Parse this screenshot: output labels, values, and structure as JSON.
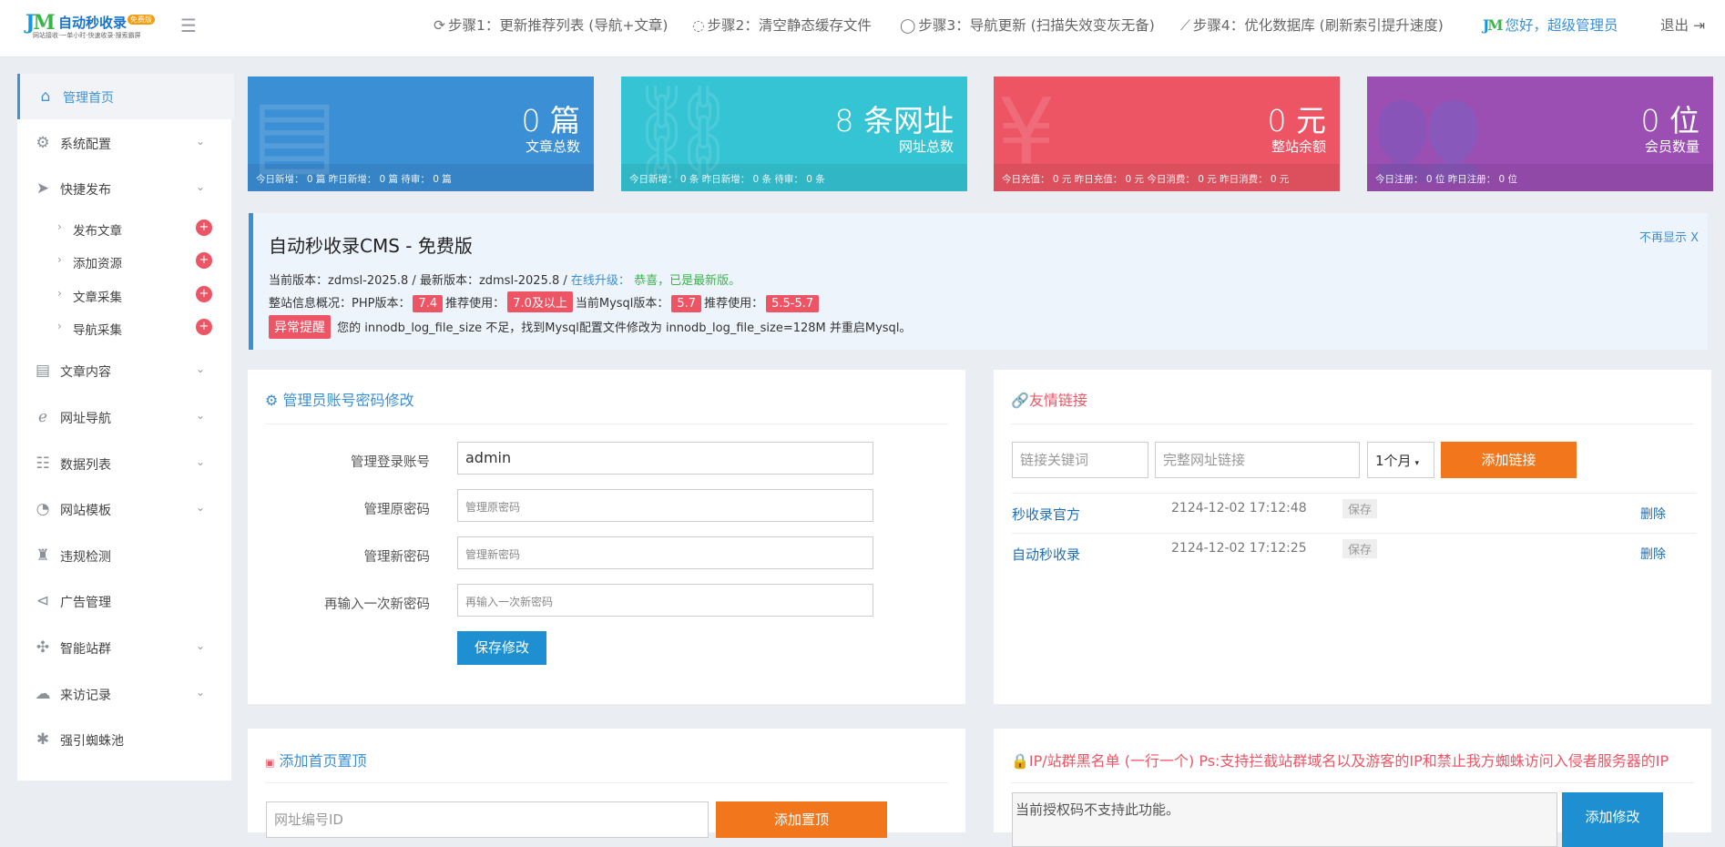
{
  "header": {
    "logo_mark": "JM",
    "logo_name": "自动秒收录",
    "logo_badge": "免费版",
    "logo_slogan": "网站接收·一单小时·快速收录·搜索霸屏",
    "steps": [
      {
        "icon": "⟳",
        "label": "步骤1：更新推荐列表 (导航+文章)"
      },
      {
        "icon": "◌",
        "label": "步骤2：清空静态缓存文件"
      },
      {
        "icon": "◯",
        "label": "步骤3：导航更新 (扫描失效变灰无备)"
      },
      {
        "icon": "⟋",
        "label": "步骤4：优化数据库 (刷新索引提升速度)"
      }
    ],
    "greeting": "您好，超级管理员",
    "logout": "退出"
  },
  "sidebar": {
    "items": [
      {
        "label": "管理首页"
      },
      {
        "label": "系统配置"
      },
      {
        "label": "快捷发布"
      },
      {
        "label": "文章内容"
      },
      {
        "label": "网址导航"
      },
      {
        "label": "数据列表"
      },
      {
        "label": "网站模板"
      },
      {
        "label": "违规检测"
      },
      {
        "label": "广告管理"
      },
      {
        "label": "智能站群"
      },
      {
        "label": "来访记录"
      },
      {
        "label": "强引蜘蛛池"
      }
    ],
    "subitems": [
      {
        "label": "发布文章"
      },
      {
        "label": "添加资源"
      },
      {
        "label": "文章采集"
      },
      {
        "label": "导航采集"
      }
    ]
  },
  "stats": [
    {
      "big": "0 篇",
      "small": "文章总数",
      "foot": "今日新增： 0 篇 昨日新增： 0 篇 待审： 0 篇",
      "color": "#3b8fd4"
    },
    {
      "big": "8 条网址",
      "small": "网址总数",
      "foot": "今日新增： 0 条 昨日新增： 0 条 待审： 0 条",
      "color": "#34c4d4"
    },
    {
      "big": "0 元",
      "small": "整站余额",
      "foot": "今日充值： 0 元 昨日充值： 0 元 今日消费： 0 元 昨日消费： 0 元",
      "color": "#ed5565"
    },
    {
      "big": "0 位",
      "small": "会员数量",
      "foot": "今日注册： 0 位 昨日注册： 0 位",
      "color": "#9b4fb3"
    }
  ],
  "notice": {
    "title": "自动秒收录CMS - 免费版",
    "dismiss": "不再显示 X",
    "version_prefix": "当前版本：zdmsl-2025.8 / 最新版本：zdmsl-2025.8 / ",
    "upgrade_link": "在线升级：",
    "upgrade_ok": "恭喜，已是最新版。",
    "env_prefix": "整站信息概况：PHP版本：",
    "php_version": "7.4",
    "recommend1": "推荐使用：",
    "php_recommend": "7.0及以上",
    "mysql_label": "当前Mysql版本：",
    "mysql_version": "5.7",
    "recommend2": "推荐使用：",
    "mysql_recommend": "5.5-5.7",
    "alert_tag": "异常提醒",
    "alert_text": "您的 innodb_log_file_size 不足，找到Mysql配置文件修改为 innodb_log_file_size=128M 并重启Mysql。"
  },
  "account_panel": {
    "title": "管理员账号密码修改",
    "fields": [
      {
        "label": "管理登录账号",
        "value": "admin",
        "placeholder": ""
      },
      {
        "label": "管理原密码",
        "value": "",
        "placeholder": "管理原密码"
      },
      {
        "label": "管理新密码",
        "value": "",
        "placeholder": "管理新密码"
      },
      {
        "label": "再输入一次新密码",
        "value": "",
        "placeholder": "再输入一次新密码"
      }
    ],
    "save_button": "保存修改"
  },
  "links_panel": {
    "title": "友情链接",
    "keyword_placeholder": "链接关键词",
    "url_placeholder": "完整网址链接",
    "duration_selected": "1个月",
    "add_button": "添加链接",
    "rows": [
      {
        "name": "秒收录官方",
        "time": "2124-12-02 17:12:48",
        "save": "保存",
        "delete": "删除"
      },
      {
        "name": "自动秒收录",
        "time": "2124-12-02 17:12:25",
        "save": "保存",
        "delete": "删除"
      }
    ]
  },
  "top_panel": {
    "title": "添加首页置顶",
    "id_placeholder": "网址编号ID",
    "add_button": "添加置顶"
  },
  "blacklist_panel": {
    "title": "IP/站群黑名单 (一行一个) Ps:支持拦截站群域名以及游客的IP和禁止我方蜘蛛访问入侵者服务器的IP",
    "textarea_value": "当前授权码不支持此功能。",
    "submit_button": "添加修改"
  }
}
